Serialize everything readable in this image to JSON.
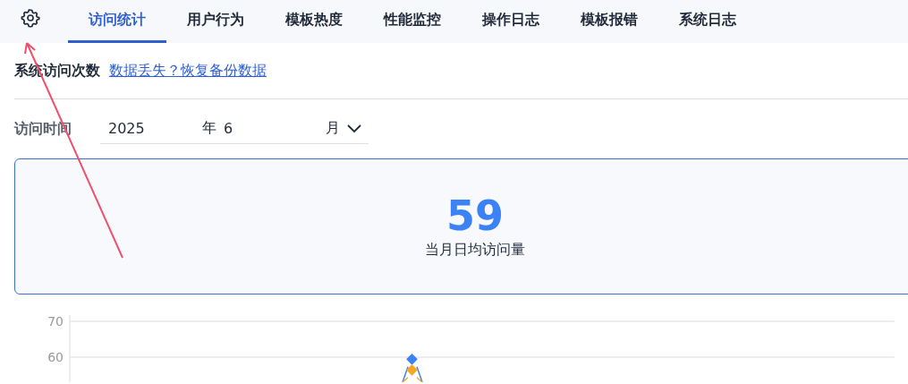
{
  "tabs": [
    {
      "label": "访问统计",
      "selected": true
    },
    {
      "label": "用户行为",
      "selected": false
    },
    {
      "label": "模板热度",
      "selected": false
    },
    {
      "label": "性能监控",
      "selected": false
    },
    {
      "label": "操作日志",
      "selected": false
    },
    {
      "label": "模板报错",
      "selected": false
    },
    {
      "label": "系统日志",
      "selected": false
    }
  ],
  "section": {
    "title": "系统访问次数",
    "link": "数据丢失？恢复备份数据"
  },
  "filter": {
    "label": "访问时间",
    "year": "2025",
    "year_unit": "年",
    "month": "6",
    "month_unit": "月"
  },
  "summary": {
    "value": "59",
    "caption": "当月日均访问量"
  },
  "chart_data": {
    "type": "line",
    "yticks": [
      60,
      70
    ],
    "ylim": [
      53,
      70
    ],
    "series": [
      {
        "color": "#3b82f6",
        "marker": "diamond",
        "values": [
          59.3
        ]
      },
      {
        "color": "#f5a623",
        "marker": "diamond",
        "values": [
          56.3
        ]
      }
    ]
  }
}
